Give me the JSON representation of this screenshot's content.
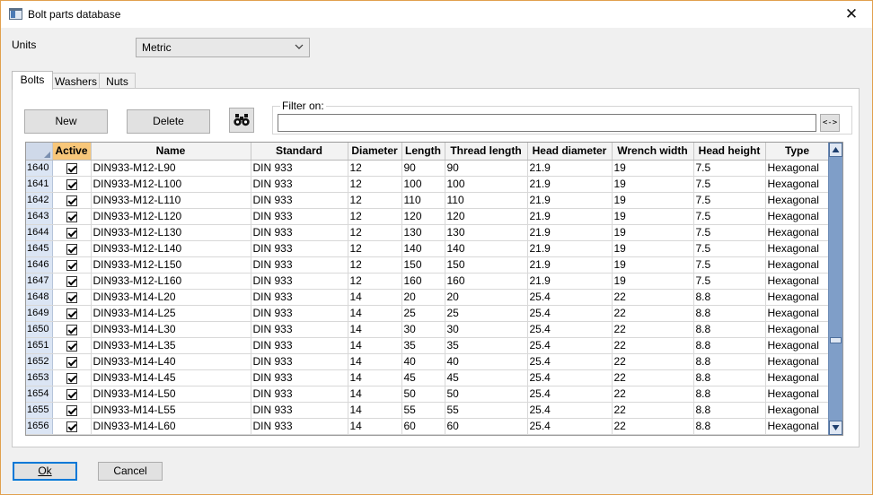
{
  "window": {
    "title": "Bolt parts database",
    "close_glyph": "✕"
  },
  "units": {
    "label": "Units",
    "selected": "Metric"
  },
  "tabs": [
    {
      "label": "Bolts",
      "active": true
    },
    {
      "label": "Washers",
      "active": false
    },
    {
      "label": "Nuts",
      "active": false
    }
  ],
  "toolbar": {
    "new_label": "New",
    "delete_label": "Delete",
    "search_icon": "binoculars-icon"
  },
  "filter": {
    "label": "Filter on:",
    "value": "",
    "clear_label": "<->"
  },
  "table": {
    "columns": [
      "Active",
      "Name",
      "Standard",
      "Diameter",
      "Length",
      "Thread length",
      "Head diameter",
      "Wrench width",
      "Head height",
      "Type"
    ],
    "rows": [
      {
        "id": "1640",
        "active": true,
        "cells": [
          "DIN933-M12-L90",
          "DIN 933",
          "12",
          "90",
          "90",
          "21.9",
          "19",
          "7.5",
          "Hexagonal"
        ]
      },
      {
        "id": "1641",
        "active": true,
        "cells": [
          "DIN933-M12-L100",
          "DIN 933",
          "12",
          "100",
          "100",
          "21.9",
          "19",
          "7.5",
          "Hexagonal"
        ]
      },
      {
        "id": "1642",
        "active": true,
        "cells": [
          "DIN933-M12-L110",
          "DIN 933",
          "12",
          "110",
          "110",
          "21.9",
          "19",
          "7.5",
          "Hexagonal"
        ]
      },
      {
        "id": "1643",
        "active": true,
        "cells": [
          "DIN933-M12-L120",
          "DIN 933",
          "12",
          "120",
          "120",
          "21.9",
          "19",
          "7.5",
          "Hexagonal"
        ]
      },
      {
        "id": "1644",
        "active": true,
        "cells": [
          "DIN933-M12-L130",
          "DIN 933",
          "12",
          "130",
          "130",
          "21.9",
          "19",
          "7.5",
          "Hexagonal"
        ]
      },
      {
        "id": "1645",
        "active": true,
        "cells": [
          "DIN933-M12-L140",
          "DIN 933",
          "12",
          "140",
          "140",
          "21.9",
          "19",
          "7.5",
          "Hexagonal"
        ]
      },
      {
        "id": "1646",
        "active": true,
        "cells": [
          "DIN933-M12-L150",
          "DIN 933",
          "12",
          "150",
          "150",
          "21.9",
          "19",
          "7.5",
          "Hexagonal"
        ]
      },
      {
        "id": "1647",
        "active": true,
        "cells": [
          "DIN933-M12-L160",
          "DIN 933",
          "12",
          "160",
          "160",
          "21.9",
          "19",
          "7.5",
          "Hexagonal"
        ]
      },
      {
        "id": "1648",
        "active": true,
        "cells": [
          "DIN933-M14-L20",
          "DIN 933",
          "14",
          "20",
          "20",
          "25.4",
          "22",
          "8.8",
          "Hexagonal"
        ]
      },
      {
        "id": "1649",
        "active": true,
        "cells": [
          "DIN933-M14-L25",
          "DIN 933",
          "14",
          "25",
          "25",
          "25.4",
          "22",
          "8.8",
          "Hexagonal"
        ]
      },
      {
        "id": "1650",
        "active": true,
        "cells": [
          "DIN933-M14-L30",
          "DIN 933",
          "14",
          "30",
          "30",
          "25.4",
          "22",
          "8.8",
          "Hexagonal"
        ]
      },
      {
        "id": "1651",
        "active": true,
        "cells": [
          "DIN933-M14-L35",
          "DIN 933",
          "14",
          "35",
          "35",
          "25.4",
          "22",
          "8.8",
          "Hexagonal"
        ]
      },
      {
        "id": "1652",
        "active": true,
        "cells": [
          "DIN933-M14-L40",
          "DIN 933",
          "14",
          "40",
          "40",
          "25.4",
          "22",
          "8.8",
          "Hexagonal"
        ]
      },
      {
        "id": "1653",
        "active": true,
        "cells": [
          "DIN933-M14-L45",
          "DIN 933",
          "14",
          "45",
          "45",
          "25.4",
          "22",
          "8.8",
          "Hexagonal"
        ]
      },
      {
        "id": "1654",
        "active": true,
        "cells": [
          "DIN933-M14-L50",
          "DIN 933",
          "14",
          "50",
          "50",
          "25.4",
          "22",
          "8.8",
          "Hexagonal"
        ]
      },
      {
        "id": "1655",
        "active": true,
        "cells": [
          "DIN933-M14-L55",
          "DIN 933",
          "14",
          "55",
          "55",
          "25.4",
          "22",
          "8.8",
          "Hexagonal"
        ]
      },
      {
        "id": "1656",
        "active": true,
        "cells": [
          "DIN933-M14-L60",
          "DIN 933",
          "14",
          "60",
          "60",
          "25.4",
          "22",
          "8.8",
          "Hexagonal"
        ]
      }
    ]
  },
  "footer": {
    "ok_label": "Ok",
    "cancel_label": "Cancel"
  },
  "colors": {
    "active_header": "#f8c77a",
    "row_header": "#dbe5f4",
    "scrollbar": "#7f9ec8"
  }
}
